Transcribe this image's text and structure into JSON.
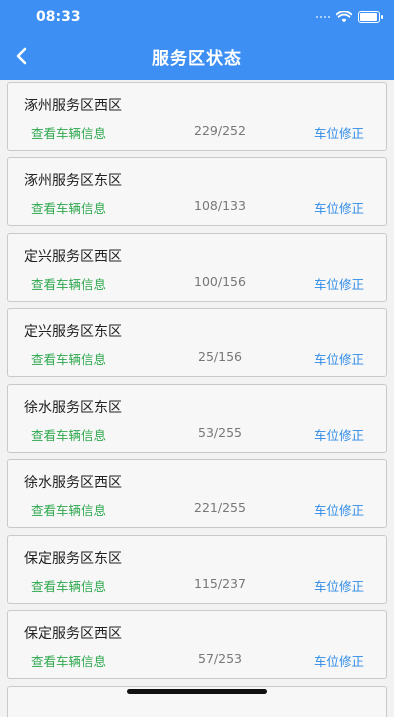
{
  "status_bar": {
    "time": "08:33",
    "wifi_icon": "wifi-icon",
    "battery_icon": "battery-icon"
  },
  "header": {
    "title": "服务区状态",
    "back_icon": "chevron-left-icon",
    "bg": "#3d8ff3"
  },
  "colors": {
    "link_green": "#2fa84f",
    "link_blue": "#2d8be8"
  },
  "items": [
    {
      "name": "涿州服务区西区",
      "view_label": "查看车辆信息",
      "count": "229/252",
      "fix_label": "车位修正"
    },
    {
      "name": "涿州服务区东区",
      "view_label": "查看车辆信息",
      "count": "108/133",
      "fix_label": "车位修正"
    },
    {
      "name": "定兴服务区西区",
      "view_label": "查看车辆信息",
      "count": "100/156",
      "fix_label": "车位修正"
    },
    {
      "name": "定兴服务区东区",
      "view_label": "查看车辆信息",
      "count": "25/156",
      "fix_label": "车位修正"
    },
    {
      "name": "徐水服务区东区",
      "view_label": "查看车辆信息",
      "count": "53/255",
      "fix_label": "车位修正"
    },
    {
      "name": "徐水服务区西区",
      "view_label": "查看车辆信息",
      "count": "221/255",
      "fix_label": "车位修正"
    },
    {
      "name": "保定服务区东区",
      "view_label": "查看车辆信息",
      "count": "115/237",
      "fix_label": "车位修正"
    },
    {
      "name": "保定服务区西区",
      "view_label": "查看车辆信息",
      "count": "57/253",
      "fix_label": "车位修正"
    }
  ]
}
